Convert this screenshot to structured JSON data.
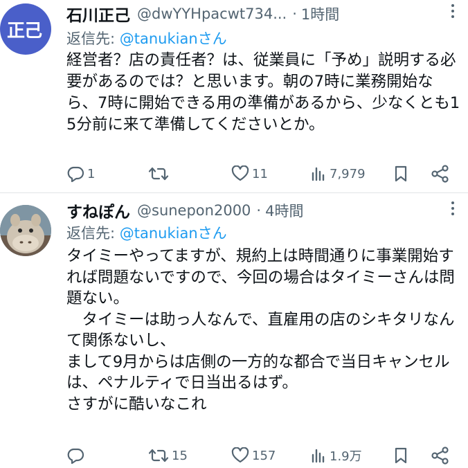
{
  "tweets": [
    {
      "avatar_text": "正己",
      "display_name": "石川正己",
      "handle": "@dwYYHpacwt734...",
      "separator": "·",
      "time": "1時間",
      "reply_prefix": "返信先: ",
      "reply_mention": "@tanukianさん",
      "body": "経営者？店の責任者？は、従業員に「予め」説明する必要があるのでは？と思います。朝の7時に業務開始なら、7時に開始できる用の準備があるから、少なくとも15分前に来て準備してくださいとか。",
      "replies": "1",
      "retweets": "",
      "likes": "11",
      "views": "7,979"
    },
    {
      "avatar_text": "",
      "display_name": "すねぽん",
      "handle": "@sunepon2000",
      "separator": "·",
      "time": "4時間",
      "reply_prefix": "返信先: ",
      "reply_mention": "@tanukianさん",
      "body": "タイミーやってますが、規約上は時間通りに事業開始すれば問題ないですので、今回の場合はタイミーさんは問題ない。\n　タイミーは助っ人なんで、直雇用の店のシキタリなんて関係ないし、\nまして9月からは店側の一方的な都合で当日キャンセルは、ペナルティで日当出るはず。\nさすがに酷いなこれ",
      "replies": "",
      "retweets": "15",
      "likes": "157",
      "views": "1.9万"
    }
  ],
  "colors": {
    "text": "#0f1419",
    "secondary": "#536471",
    "link": "#1d9bf0",
    "avatar_1_bg": "#4a5fc9"
  },
  "icons": [
    "more-icon",
    "reply-icon",
    "retweet-icon",
    "like-icon",
    "views-icon",
    "bookmark-icon",
    "share-icon"
  ]
}
